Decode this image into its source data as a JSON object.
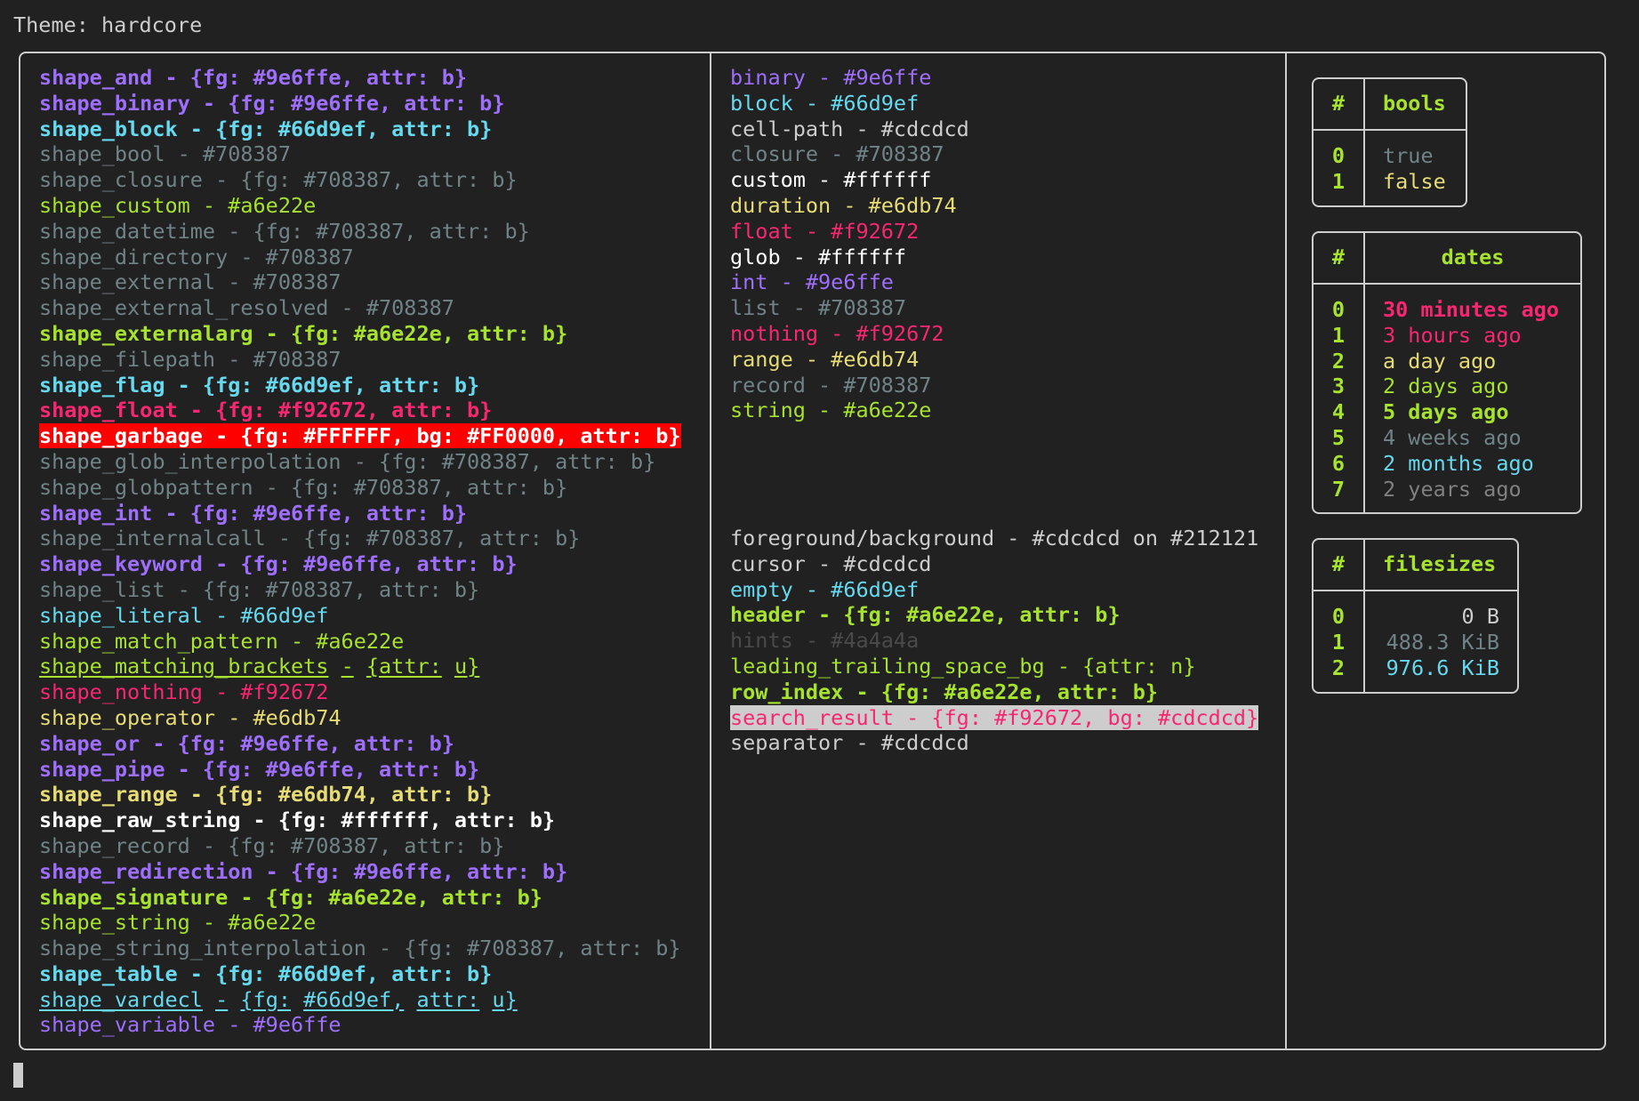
{
  "theme_title": "Theme: hardcore",
  "colors": {
    "foreground": "#cdcdcd",
    "background": "#212121",
    "border": "#cdcdcd",
    "purple": "#9e6ffe",
    "cyan": "#66d9ef",
    "gray": "#708387",
    "green": "#a6e22e",
    "yellow": "#e6db74",
    "pink": "#f92672",
    "white": "#ffffff",
    "hint": "#4a4a4a"
  },
  "shape_styles": [
    {
      "text": "shape_and - {fg: #9e6ffe, attr: b}",
      "fg": "#9e6ffe",
      "bold": true
    },
    {
      "text": "shape_binary - {fg: #9e6ffe, attr: b}",
      "fg": "#9e6ffe",
      "bold": true
    },
    {
      "text": "shape_block - {fg: #66d9ef, attr: b}",
      "fg": "#66d9ef",
      "bold": true
    },
    {
      "text": "shape_bool - #708387",
      "fg": "#708387"
    },
    {
      "text": "shape_closure - {fg: #708387, attr: b}",
      "fg": "#708387"
    },
    {
      "text": "shape_custom - #a6e22e",
      "fg": "#a6e22e"
    },
    {
      "text": "shape_datetime - {fg: #708387, attr: b}",
      "fg": "#708387"
    },
    {
      "text": "shape_directory - #708387",
      "fg": "#708387"
    },
    {
      "text": "shape_external - #708387",
      "fg": "#708387"
    },
    {
      "text": "shape_external_resolved - #708387",
      "fg": "#708387"
    },
    {
      "text": "shape_externalarg - {fg: #a6e22e, attr: b}",
      "fg": "#a6e22e",
      "bold": true
    },
    {
      "text": "shape_filepath - #708387",
      "fg": "#708387"
    },
    {
      "text": "shape_flag - {fg: #66d9ef, attr: b}",
      "fg": "#66d9ef",
      "bold": true
    },
    {
      "text": "shape_float - {fg: #f92672, attr: b}",
      "fg": "#f92672",
      "bold": true
    },
    {
      "text": "shape_garbage - {fg: #FFFFFF, bg: #FF0000, attr: b}",
      "fg": "#FFFFFF",
      "bg": "#FF0000",
      "bold": true
    },
    {
      "text": "shape_glob_interpolation - {fg: #708387, attr: b}",
      "fg": "#708387"
    },
    {
      "text": "shape_globpattern - {fg: #708387, attr: b}",
      "fg": "#708387"
    },
    {
      "text": "shape_int - {fg: #9e6ffe, attr: b}",
      "fg": "#9e6ffe",
      "bold": true
    },
    {
      "text": "shape_internalcall - {fg: #708387, attr: b}",
      "fg": "#708387"
    },
    {
      "text": "shape_keyword - {fg: #9e6ffe, attr: b}",
      "fg": "#9e6ffe",
      "bold": true
    },
    {
      "text": "shape_list - {fg: #708387, attr: b}",
      "fg": "#708387"
    },
    {
      "text": "shape_literal - #66d9ef",
      "fg": "#66d9ef"
    },
    {
      "text": "shape_match_pattern - #a6e22e",
      "fg": "#a6e22e"
    },
    {
      "text": "shape_matching_brackets - {attr: u}",
      "fg": "#a6e22e",
      "underline": true
    },
    {
      "text": "shape_nothing - #f92672",
      "fg": "#f92672"
    },
    {
      "text": "shape_operator - #e6db74",
      "fg": "#e6db74"
    },
    {
      "text": "shape_or - {fg: #9e6ffe, attr: b}",
      "fg": "#9e6ffe",
      "bold": true
    },
    {
      "text": "shape_pipe - {fg: #9e6ffe, attr: b}",
      "fg": "#9e6ffe",
      "bold": true
    },
    {
      "text": "shape_range - {fg: #e6db74, attr: b}",
      "fg": "#e6db74",
      "bold": true
    },
    {
      "text": "shape_raw_string - {fg: #ffffff, attr: b}",
      "fg": "#ffffff",
      "bold": true
    },
    {
      "text": "shape_record - {fg: #708387, attr: b}",
      "fg": "#708387"
    },
    {
      "text": "shape_redirection - {fg: #9e6ffe, attr: b}",
      "fg": "#9e6ffe",
      "bold": true
    },
    {
      "text": "shape_signature - {fg: #a6e22e, attr: b}",
      "fg": "#a6e22e",
      "bold": true
    },
    {
      "text": "shape_string - #a6e22e",
      "fg": "#a6e22e"
    },
    {
      "text": "shape_string_interpolation - {fg: #708387, attr: b}",
      "fg": "#708387"
    },
    {
      "text": "shape_table - {fg: #66d9ef, attr: b}",
      "fg": "#66d9ef",
      "bold": true
    },
    {
      "text": "shape_vardecl - {fg: #66d9ef, attr: u}",
      "fg": "#66d9ef",
      "underline": true
    },
    {
      "text": "shape_variable - #9e6ffe",
      "fg": "#9e6ffe"
    }
  ],
  "type_colors": [
    {
      "text": "binary - #9e6ffe",
      "fg": "#9e6ffe"
    },
    {
      "text": "block - #66d9ef",
      "fg": "#66d9ef"
    },
    {
      "text": "cell-path - #cdcdcd",
      "fg": "#cdcdcd"
    },
    {
      "text": "closure - #708387",
      "fg": "#708387"
    },
    {
      "text": "custom - #ffffff",
      "fg": "#ffffff"
    },
    {
      "text": "duration - #e6db74",
      "fg": "#e6db74"
    },
    {
      "text": "float - #f92672",
      "fg": "#f92672"
    },
    {
      "text": "glob - #ffffff",
      "fg": "#ffffff"
    },
    {
      "text": "int - #9e6ffe",
      "fg": "#9e6ffe"
    },
    {
      "text": "list - #708387",
      "fg": "#708387"
    },
    {
      "text": "nothing - #f92672",
      "fg": "#f92672"
    },
    {
      "text": "range - #e6db74",
      "fg": "#e6db74"
    },
    {
      "text": "record - #708387",
      "fg": "#708387"
    },
    {
      "text": "string - #a6e22e",
      "fg": "#a6e22e"
    }
  ],
  "ui_colors": [
    {
      "text": "foreground/background - #cdcdcd on #212121",
      "fg": "#cdcdcd"
    },
    {
      "text": "cursor - #cdcdcd",
      "fg": "#cdcdcd"
    },
    {
      "text": "empty - #66d9ef",
      "fg": "#66d9ef"
    },
    {
      "text": "header - {fg: #a6e22e, attr: b}",
      "fg": "#a6e22e",
      "bold": true
    },
    {
      "text": "hints - #4a4a4a",
      "fg": "#4a4a4a"
    },
    {
      "text": "leading_trailing_space_bg - {attr: n}",
      "fg": "#a6e22e"
    },
    {
      "text": "row_index - {fg: #a6e22e, attr: b}",
      "fg": "#a6e22e",
      "bold": true
    },
    {
      "text": "search_result - {fg: #f92672, bg: #cdcdcd}",
      "fg": "#f92672",
      "bg": "#cdcdcd"
    },
    {
      "text": "separator - #cdcdcd",
      "fg": "#cdcdcd"
    }
  ],
  "tables": {
    "bools": {
      "index_header": "#",
      "header": "bools",
      "rows": [
        {
          "index": "0",
          "value": "true",
          "fg": "#708387"
        },
        {
          "index": "1",
          "value": "false",
          "fg": "#e6db74"
        }
      ]
    },
    "dates": {
      "index_header": "#",
      "header": "dates",
      "rows": [
        {
          "index": "0",
          "value": "30 minutes ago",
          "fg": "#f92672",
          "bold": true
        },
        {
          "index": "1",
          "value": "3 hours ago",
          "fg": "#f92672"
        },
        {
          "index": "2",
          "value": "a day ago",
          "fg": "#e6db74"
        },
        {
          "index": "3",
          "value": "2 days ago",
          "fg": "#a6e22e"
        },
        {
          "index": "4",
          "value": "5 days ago",
          "fg": "#a6e22e",
          "bold": true
        },
        {
          "index": "5",
          "value": "4 weeks ago",
          "fg": "#708387"
        },
        {
          "index": "6",
          "value": "2 months ago",
          "fg": "#66d9ef"
        },
        {
          "index": "7",
          "value": "2 years ago",
          "fg": "#808080"
        }
      ]
    },
    "filesizes": {
      "index_header": "#",
      "header": "filesizes",
      "rows": [
        {
          "index": "0",
          "value": "0 B",
          "fg": "#cdcdcd"
        },
        {
          "index": "1",
          "value": "488.3 KiB",
          "fg": "#708387"
        },
        {
          "index": "2",
          "value": "976.6 KiB",
          "fg": "#66d9ef"
        }
      ]
    }
  }
}
